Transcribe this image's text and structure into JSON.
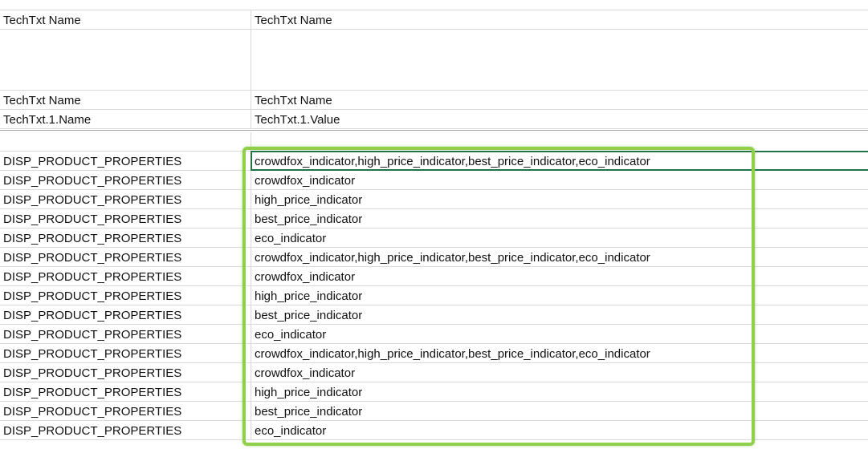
{
  "header_rows": [
    {
      "col_a": "TechTxt Name",
      "col_b": "TechTxt Name"
    },
    {
      "col_a": "",
      "col_b": ""
    },
    {
      "col_a": "TechTxt Name",
      "col_b": "TechTxt Name"
    },
    {
      "col_a": "TechTxt.1.Name",
      "col_b": "TechTxt.1.Value"
    }
  ],
  "data_rows": [
    {
      "col_a": "DISP_PRODUCT_PROPERTIES",
      "col_b": "crowdfox_indicator,high_price_indicator,best_price_indicator,eco_indicator"
    },
    {
      "col_a": "DISP_PRODUCT_PROPERTIES",
      "col_b": "crowdfox_indicator"
    },
    {
      "col_a": "DISP_PRODUCT_PROPERTIES",
      "col_b": "high_price_indicator"
    },
    {
      "col_a": "DISP_PRODUCT_PROPERTIES",
      "col_b": "best_price_indicator"
    },
    {
      "col_a": "DISP_PRODUCT_PROPERTIES",
      "col_b": "eco_indicator"
    },
    {
      "col_a": "DISP_PRODUCT_PROPERTIES",
      "col_b": "crowdfox_indicator,high_price_indicator,best_price_indicator,eco_indicator"
    },
    {
      "col_a": "DISP_PRODUCT_PROPERTIES",
      "col_b": "crowdfox_indicator"
    },
    {
      "col_a": "DISP_PRODUCT_PROPERTIES",
      "col_b": "high_price_indicator"
    },
    {
      "col_a": "DISP_PRODUCT_PROPERTIES",
      "col_b": "best_price_indicator"
    },
    {
      "col_a": "DISP_PRODUCT_PROPERTIES",
      "col_b": "eco_indicator"
    },
    {
      "col_a": "DISP_PRODUCT_PROPERTIES",
      "col_b": "crowdfox_indicator,high_price_indicator,best_price_indicator,eco_indicator"
    },
    {
      "col_a": "DISP_PRODUCT_PROPERTIES",
      "col_b": "crowdfox_indicator"
    },
    {
      "col_a": "DISP_PRODUCT_PROPERTIES",
      "col_b": "high_price_indicator"
    },
    {
      "col_a": "DISP_PRODUCT_PROPERTIES",
      "col_b": "best_price_indicator"
    },
    {
      "col_a": "DISP_PRODUCT_PROPERTIES",
      "col_b": "eco_indicator"
    }
  ],
  "colors": {
    "gridline": "#d9d9d9",
    "active_cell_border": "#217346",
    "highlight_border": "#8fcf4a"
  }
}
